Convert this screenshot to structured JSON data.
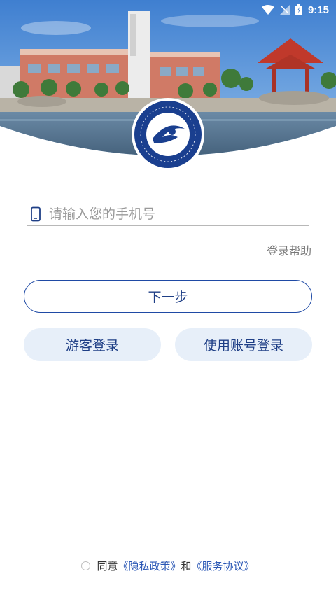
{
  "status_bar": {
    "time": "9:15"
  },
  "login": {
    "phone_placeholder": "请输入您的手机号",
    "help_link": "登录帮助",
    "next_button": "下一步",
    "guest_button": "游客登录",
    "account_button": "使用账号登录"
  },
  "agreement": {
    "prefix": "同意",
    "privacy_link": "《隐私政策》",
    "conjunction": "和",
    "service_link": "《服务协议》"
  },
  "theme": {
    "accent": "#1f4aa5",
    "secondary_bg": "#e7eff9"
  }
}
